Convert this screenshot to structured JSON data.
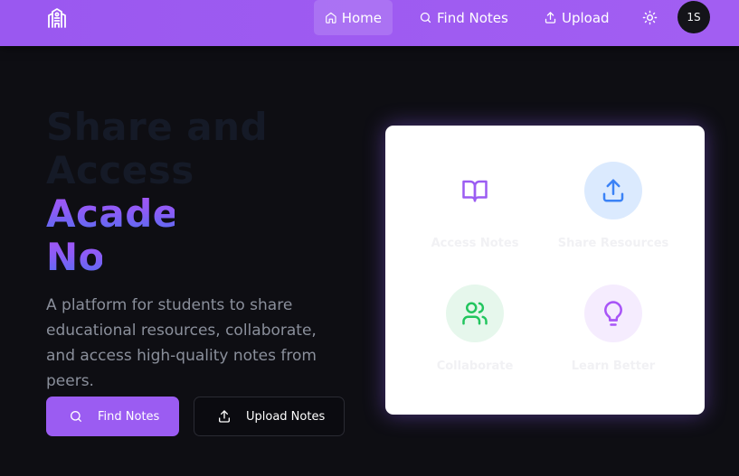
{
  "header": {
    "nav": {
      "home": "Home",
      "find_notes": "Find Notes",
      "upload": "Upload"
    },
    "avatar_initials": "1S",
    "icons": {
      "logo": "school-building-icon",
      "home": "home-icon",
      "find": "search-icon",
      "upload": "upload-icon",
      "theme": "sun-icon"
    },
    "colors": {
      "bar": "#9a58f0"
    }
  },
  "hero": {
    "title_line1": "Share and",
    "title_line2": "Access",
    "title_highlight_1": "Academic",
    "title_highlight_2": "Notes",
    "description": "A platform for students to share educational resources, collaborate, and access high-quality notes from peers."
  },
  "buttons": {
    "find_notes": "Find Notes",
    "upload_notes": "Upload Notes",
    "accent": "#9b5cf2"
  },
  "features": [
    {
      "label": "Access Notes",
      "icon": "open-book-icon",
      "color": "#9b5cf2"
    },
    {
      "label": "Share Resources",
      "icon": "upload-icon",
      "color": "#3b82f6"
    },
    {
      "label": "Collaborate",
      "icon": "users-icon",
      "color": "#22c55e"
    },
    {
      "label": "Learn Better",
      "icon": "lightbulb-icon",
      "color": "#a855f7"
    }
  ]
}
